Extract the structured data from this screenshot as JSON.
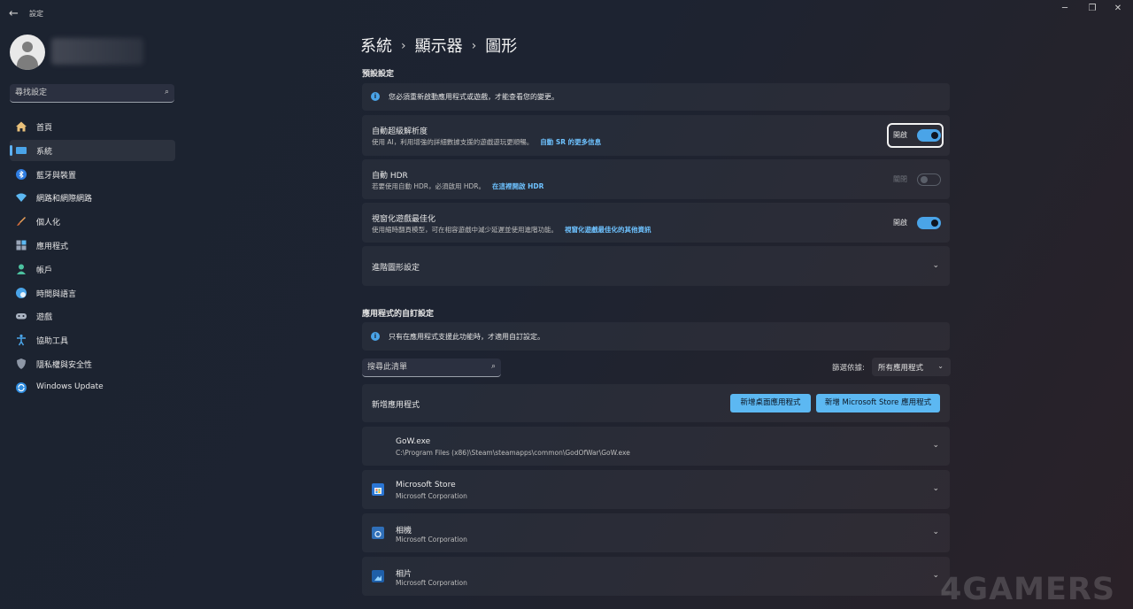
{
  "window": {
    "back_icon": "back-arrow-icon",
    "title": "設定",
    "minimize": "─",
    "maximize": "❐",
    "close": "✕"
  },
  "sidebar": {
    "search_placeholder": "尋找設定",
    "items": [
      {
        "label": "首頁",
        "icon": "home-icon"
      },
      {
        "label": "系統",
        "icon": "display-icon"
      },
      {
        "label": "藍牙與裝置",
        "icon": "bluetooth-icon"
      },
      {
        "label": "網路和網際網路",
        "icon": "wifi-icon"
      },
      {
        "label": "個人化",
        "icon": "brush-icon"
      },
      {
        "label": "應用程式",
        "icon": "apps-icon"
      },
      {
        "label": "帳戶",
        "icon": "person-icon"
      },
      {
        "label": "時間與語言",
        "icon": "globe-clock-icon"
      },
      {
        "label": "遊戲",
        "icon": "gamepad-icon"
      },
      {
        "label": "協助工具",
        "icon": "accessibility-icon"
      },
      {
        "label": "隱私權與安全性",
        "icon": "shield-icon"
      },
      {
        "label": "Windows Update",
        "icon": "update-icon"
      }
    ],
    "selected_index": 1
  },
  "breadcrumb": {
    "items": [
      "系統",
      "顯示器",
      "圖形"
    ],
    "separator": "›"
  },
  "defaults": {
    "title": "預設設定",
    "info": "您必須重新啟動應用程式或遊戲，才能查看您的變更。",
    "auto_sr": {
      "title": "自動超級解析度",
      "subtitle": "使用 AI，利用增強的詳細數據支援的遊戲遊玩更順暢。",
      "link": "自動 SR 的更多信息",
      "toggle_label": "開啟",
      "on": true
    },
    "auto_hdr": {
      "title": "自動 HDR",
      "subtitle": "若要使用自動 HDR，必須啟用 HDR。",
      "link": "在這裡開啟 HDR",
      "toggle_label": "關閉",
      "on": false
    },
    "windowed_opt": {
      "title": "視窗化遊戲最佳化",
      "subtitle": "使用縮時翻頁模型，可在相容遊戲中減少延遲並使用進階功能。",
      "link": "視窗化遊戲最佳化的其他資訊",
      "toggle_label": "開啟",
      "on": true
    },
    "advanced": {
      "title": "進階圖形設定"
    }
  },
  "custom": {
    "title": "應用程式的自訂設定",
    "info": "只有在應用程式支援此功能時，才適用自訂設定。",
    "filter_placeholder": "搜尋此清單",
    "sort_label": "篩選依據:",
    "sort_value": "所有應用程式",
    "add_label": "新增應用程式",
    "add_desktop_btn": "新增桌面應用程式",
    "add_store_btn": "新增 Microsoft Store 應用程式",
    "apps": [
      {
        "name": "GoW.exe",
        "detail": "C:\\Program Files (x86)\\Steam\\steamapps\\common\\GodOfWar\\GoW.exe",
        "icon": "none"
      },
      {
        "name": "Microsoft Store",
        "detail": "Microsoft Corporation",
        "icon": "store-icon"
      },
      {
        "name": "相機",
        "detail": "Microsoft Corporation",
        "icon": "camera-icon"
      },
      {
        "name": "相片",
        "detail": "Microsoft Corporation",
        "icon": "photos-icon"
      }
    ]
  },
  "watermark": "4GAMERS",
  "colors": {
    "accent": "#5cb8f2",
    "link": "#6ec2ff",
    "info": "#4aa4e8"
  }
}
